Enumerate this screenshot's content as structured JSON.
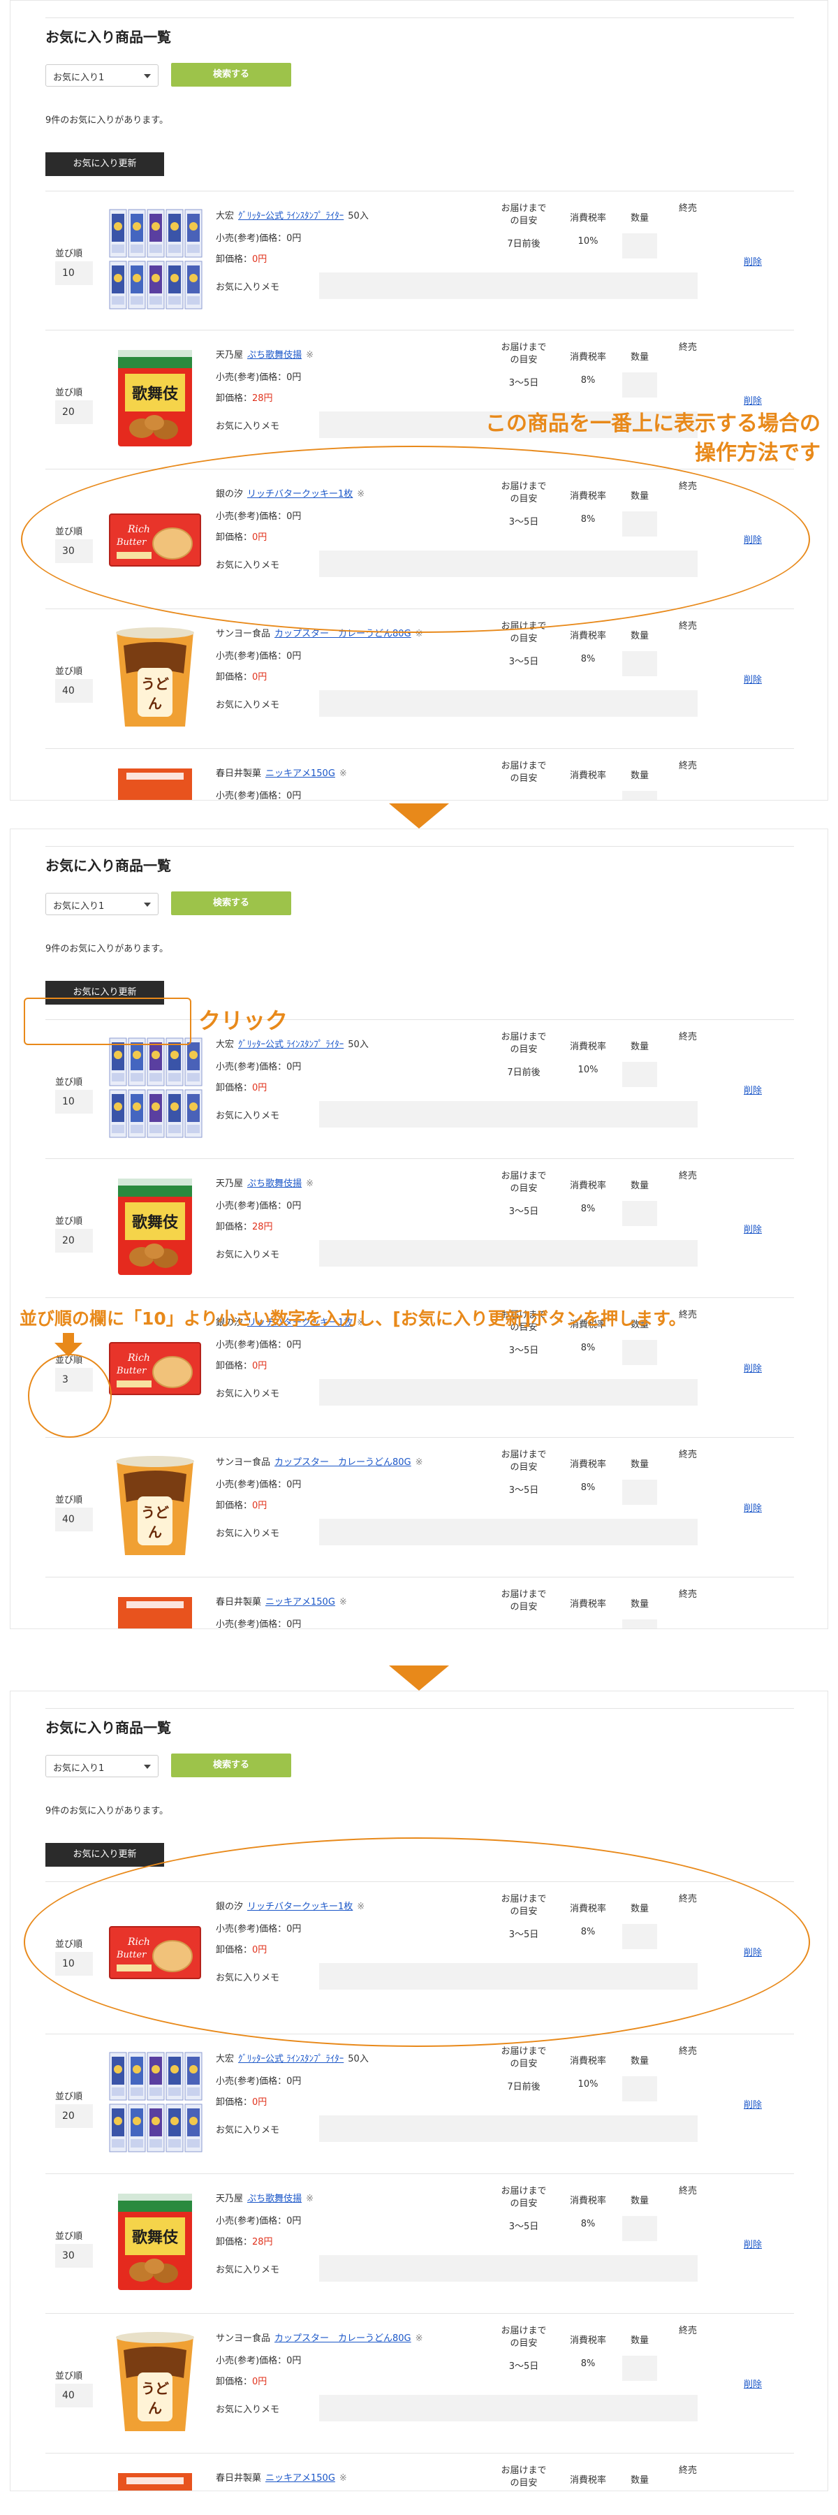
{
  "page_title": "お気に入り商品一覧",
  "select_value": "お気に入り1",
  "search_label": "検索する",
  "count_text": "9件のお気に入りがあります。",
  "update_label": "お気に入り更新",
  "labels": {
    "order": "並び順",
    "retail": "小売(参考)価格：0円",
    "wholesale": "卸価格：",
    "memo": "お気に入りメモ",
    "delivery": "お届けまでの目安",
    "delivery_line1": "お届けまで",
    "delivery_line2": "の目安",
    "tax": "消費税率",
    "qty": "数量",
    "discontinued": "終売",
    "delete": "削除"
  },
  "products": {
    "sports": {
      "maker": "大宏",
      "name": "ｸﾞﾘｯﾀｰ公式 ﾗｲﾝｽﾀﾝﾌﾟ ﾗｲﾀｰ",
      "qty": "50入",
      "price": "0円",
      "delivery": "7日前後",
      "tax": "10%"
    },
    "kabuki": {
      "maker": "天乃屋",
      "name": "ぷち歌舞伎揚",
      "mark": "※",
      "price": "28円",
      "delivery": "3～5日",
      "tax": "8%"
    },
    "cookie": {
      "maker": "銀の汐",
      "name": "リッチバタークッキー1枚",
      "mark": "※",
      "price": "0円",
      "delivery": "3～5日",
      "tax": "8%"
    },
    "udon": {
      "maker": "サンヨー食品",
      "name": "カップスター　カレーうどん80G",
      "mark": "※",
      "price": "0円",
      "delivery": "3～5日",
      "tax": "8%"
    },
    "nikki": {
      "maker": "春日井製菓",
      "name": "ニッキアメ150G",
      "mark": "※"
    }
  },
  "panels": [
    {
      "orders": [
        "10",
        "20",
        "30",
        "40",
        ""
      ]
    },
    {
      "orders": [
        "10",
        "20",
        "3",
        "40",
        ""
      ]
    },
    {
      "orders": [
        "10",
        "20",
        "30",
        "40",
        ""
      ]
    }
  ],
  "annotations": {
    "top_note_line1": "この商品を一番上に表示する場合の",
    "top_note_line2": "操作方法です",
    "click_note": "クリック",
    "input_note": "並び順の欄に「10」より小さい数字を入力し、[お気に入り更新]ボタンを押します。"
  },
  "colors": {
    "accent_orange": "#e8891a",
    "search_green": "#9dc34a",
    "update_dark": "#2b2b2b",
    "price_red": "#e0311b",
    "link_blue": "#1a56c8"
  },
  "icons": {
    "arrow": "down-arrow-icon",
    "select_caret": "chevron-down-icon"
  }
}
